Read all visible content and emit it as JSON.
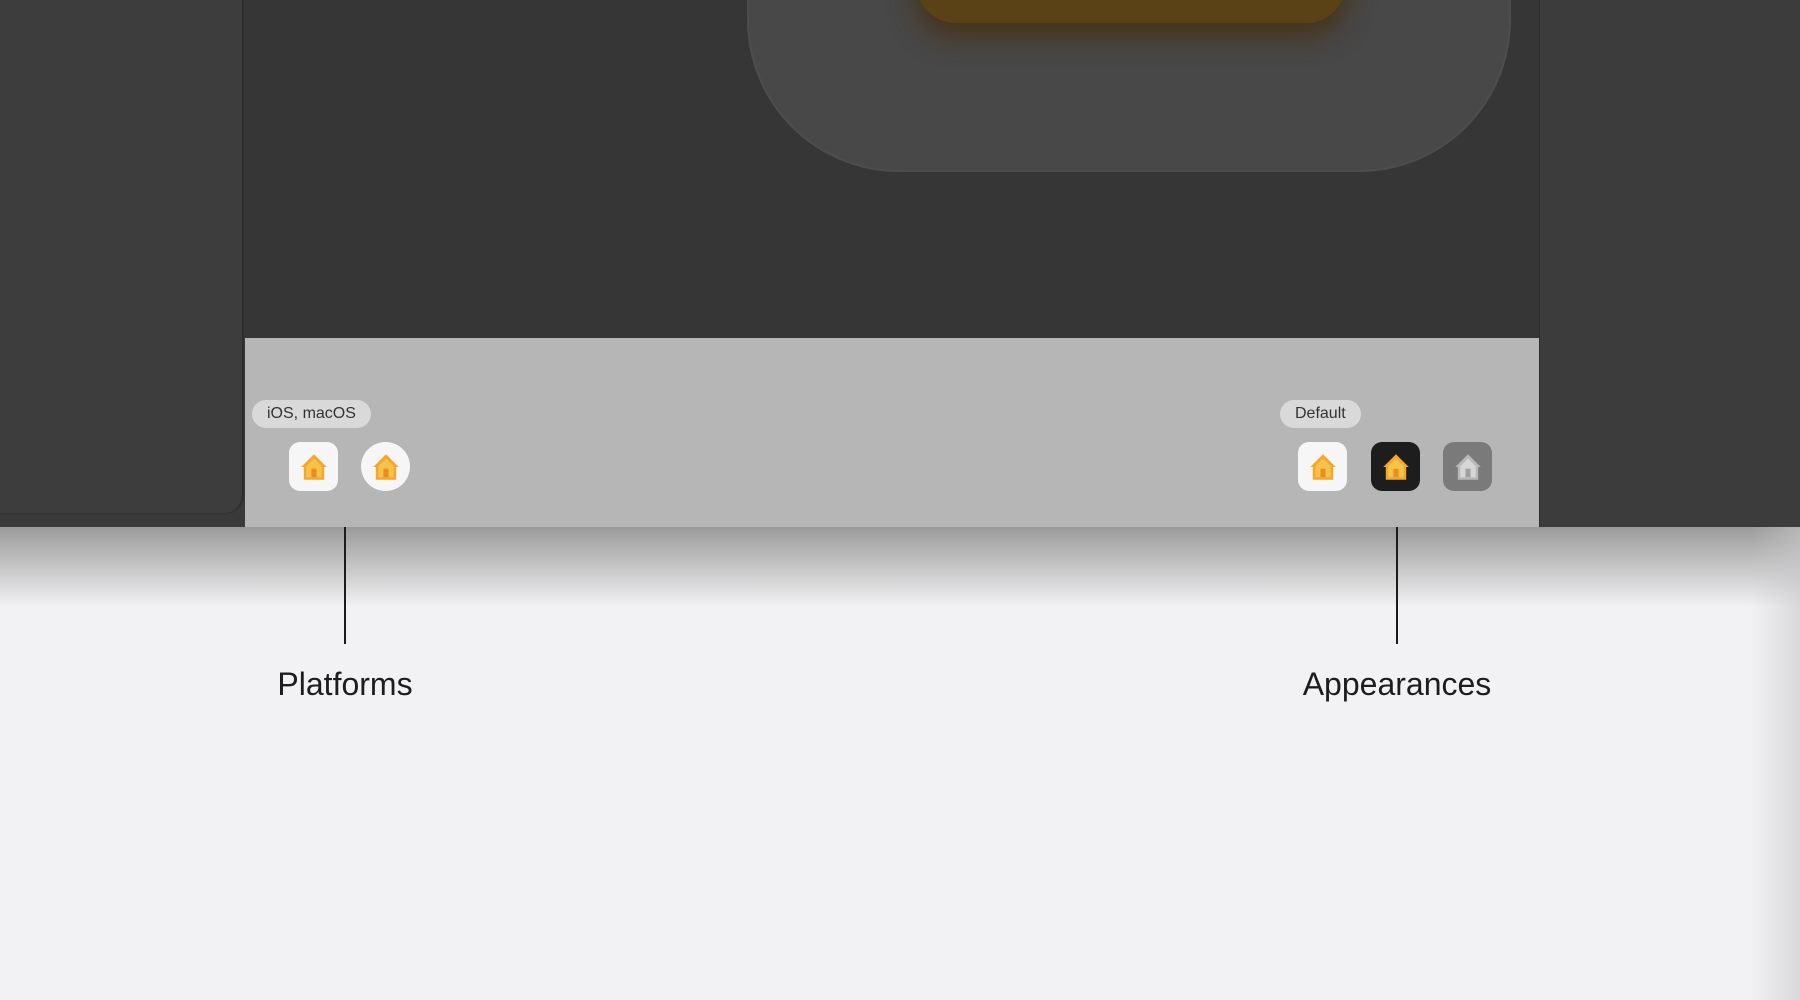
{
  "preview": {
    "platforms_pill": "iOS, macOS",
    "appearances_pill": "Default",
    "platform_icons": [
      "home-icon-ios",
      "home-icon-macos"
    ],
    "appearance_icons": [
      "home-icon-default",
      "home-icon-dark",
      "home-icon-tinted"
    ]
  },
  "annotations": {
    "platforms": "Platforms",
    "appearances": "Appearances"
  },
  "colors": {
    "icon_orange": "#f3a72c",
    "icon_gold": "#f7c24a",
    "dark_tile": "#1d1d1d",
    "tinted_tile": "#7a7a7a"
  }
}
